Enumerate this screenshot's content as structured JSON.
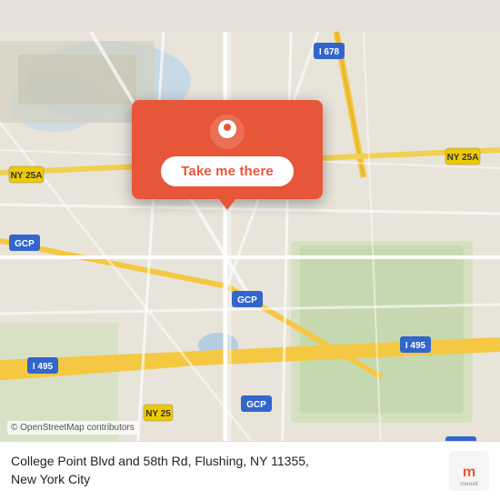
{
  "map": {
    "bg_color": "#e8e4da",
    "popup": {
      "button_label": "Take me there",
      "bg_color": "#e8563a"
    },
    "osm_attribution": "© OpenStreetMap contributors",
    "address_line1": "College Point Blvd and 58th Rd, Flushing, NY 11355,",
    "address_line2": "New York City",
    "moovit_alt": "moovit"
  }
}
